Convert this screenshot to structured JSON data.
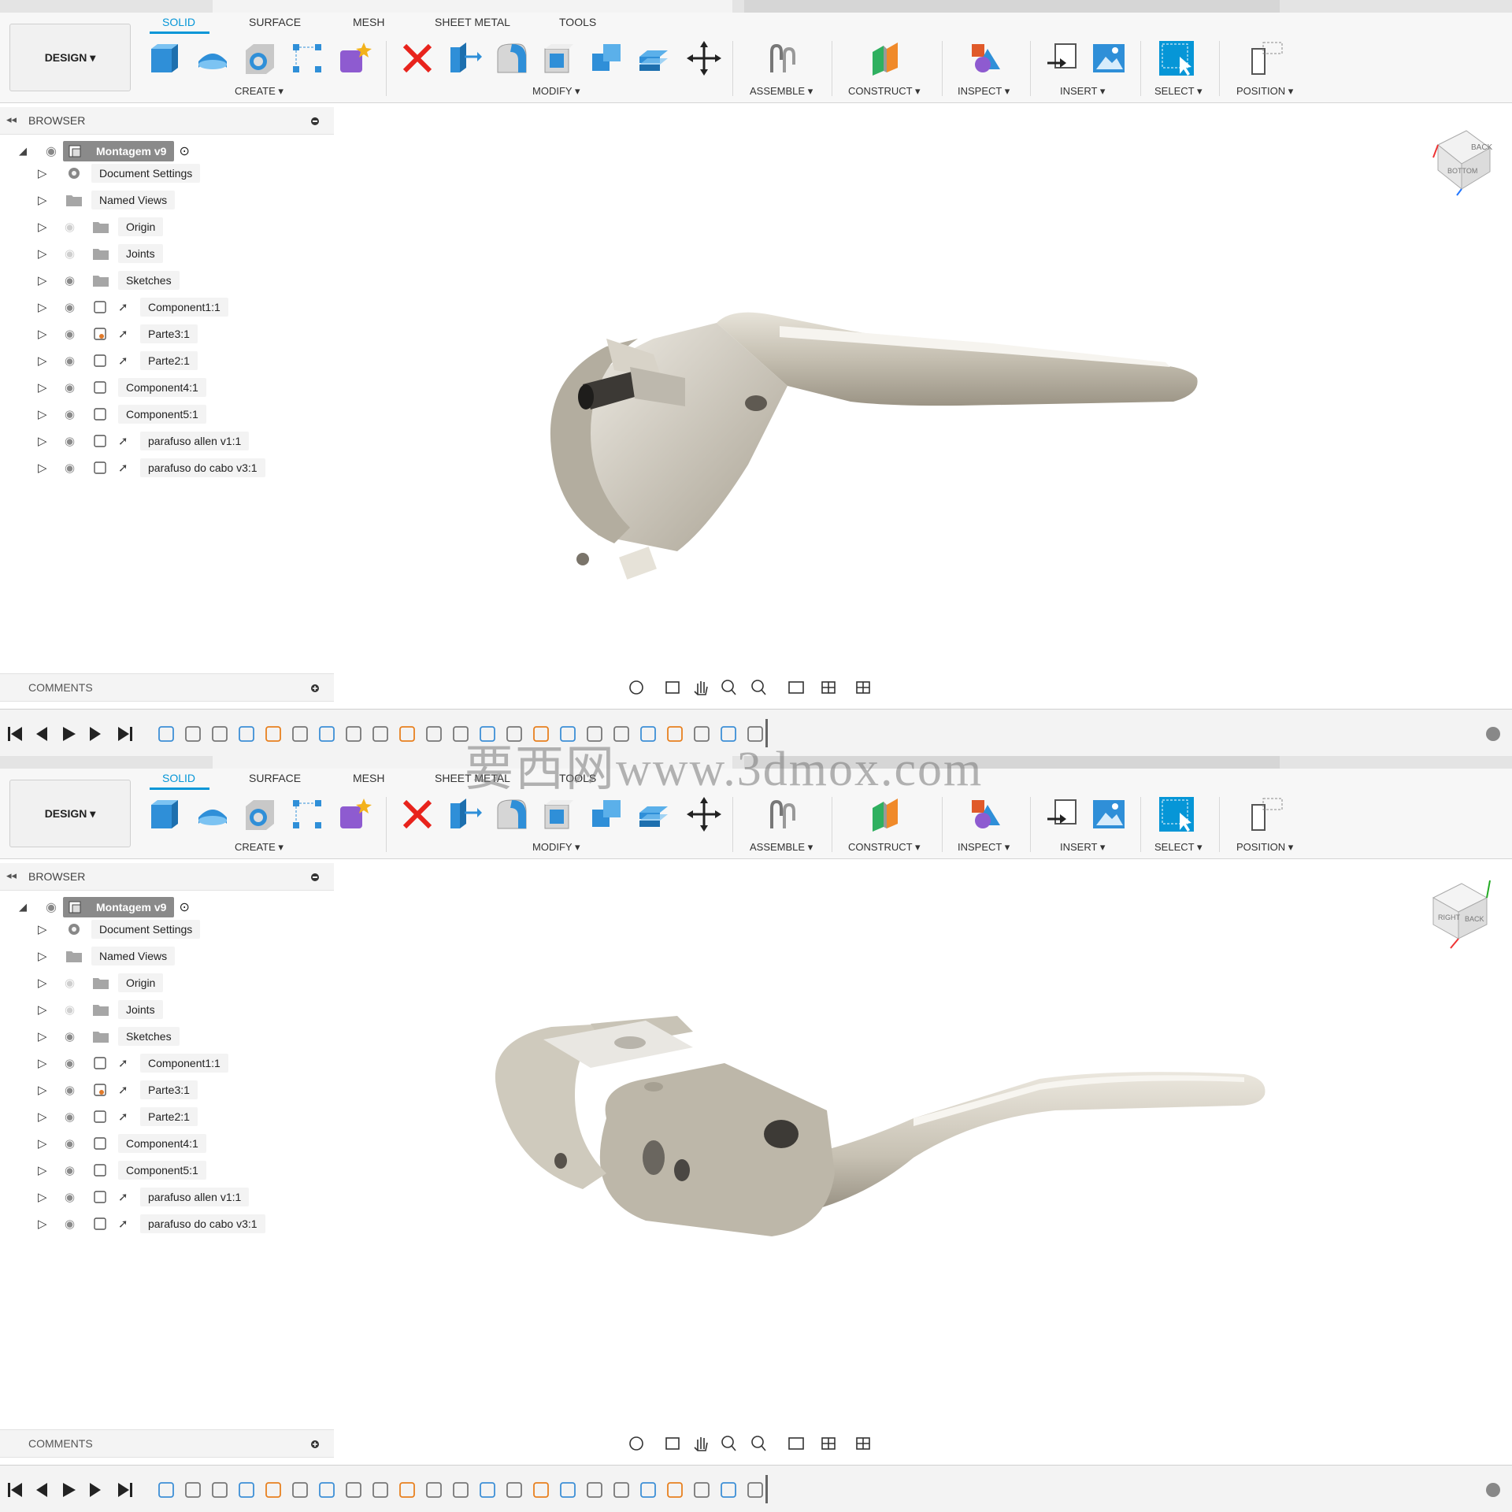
{
  "app": {
    "workspace_label": "DESIGN",
    "tabs": [
      "SOLID",
      "SURFACE",
      "MESH",
      "SHEET METAL",
      "TOOLS"
    ],
    "groups": [
      "CREATE",
      "MODIFY",
      "ASSEMBLE",
      "CONSTRUCT",
      "INSPECT",
      "INSERT",
      "SELECT",
      "POSITION"
    ]
  },
  "browser": {
    "title": "BROWSER",
    "root": "Montagem v9",
    "items": [
      "Document Settings",
      "Named Views",
      "Origin",
      "Joints",
      "Sketches",
      "Component1:1",
      "Parte3:1",
      "Parte2:1",
      "Component4:1",
      "Component5:1",
      "parafuso allen v1:1",
      "parafuso do cabo v3:1"
    ]
  },
  "comments": {
    "title": "COMMENTS"
  },
  "viewcube": {
    "top_view": [
      "BACK",
      "BOTTOM"
    ],
    "bottom_view": [
      "RIGHT",
      "BACK"
    ]
  },
  "watermark": "要西网www.3dmox.com",
  "colors": {
    "accent": "#0696d7",
    "part": "#c9c3b4"
  }
}
